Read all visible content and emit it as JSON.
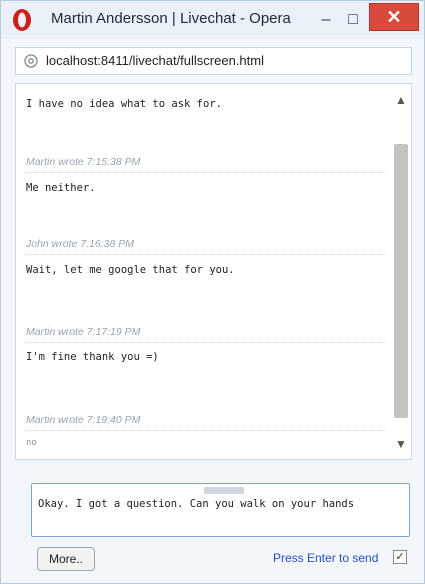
{
  "window": {
    "title": "Martin Andersson | Livechat - Opera",
    "minimize_glyph": "–",
    "maximize_glyph": "□",
    "close_glyph": "✕"
  },
  "address": {
    "url": "localhost:8411/livechat/fullscreen.html"
  },
  "messages": [
    {
      "text": "I have no idea what to ask for."
    },
    {
      "meta": "Martin wrote 7:15:38 PM",
      "text": "Me neither."
    },
    {
      "meta": "John wrote 7:16:38 PM",
      "text": "Wait, let me google that for you."
    },
    {
      "meta": "Martin wrote 7:17:19 PM",
      "text": "I'm fine thank you =)"
    },
    {
      "meta": "Martin wrote 7:19:40 PM",
      "text": "no"
    }
  ],
  "input": {
    "value": "Okay. I got a question. Can you walk on your hands"
  },
  "controls": {
    "more_label": "More..",
    "enter_label": "Press Enter to send",
    "enter_checked": true
  },
  "icons": {
    "browser": "opera-logo-icon",
    "site": "globe-icon",
    "checkmark": "✓"
  },
  "colors": {
    "close_button": "#d84a3b",
    "link_blue": "#2150c4",
    "opera_red": "#cc1f1a"
  }
}
